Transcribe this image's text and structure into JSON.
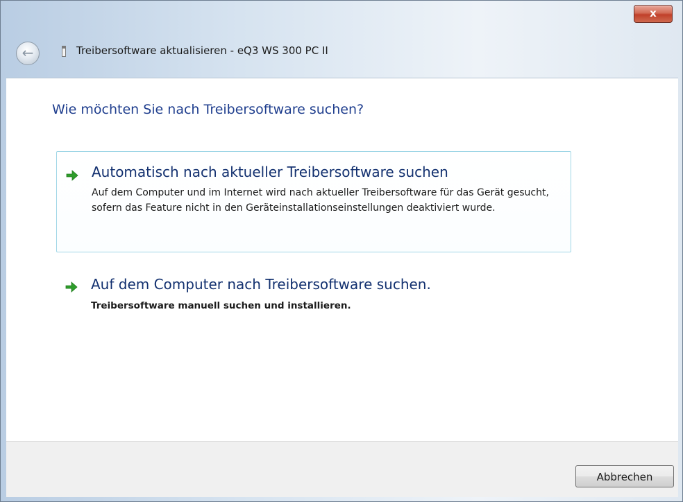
{
  "window": {
    "title": "Treibersoftware aktualisieren - eQ3 WS 300 PC II",
    "close_label": "x"
  },
  "main": {
    "heading": "Wie möchten Sie nach Treibersoftware suchen?",
    "options": [
      {
        "title": "Automatisch nach aktueller Treibersoftware suchen",
        "description": "Auf dem Computer und im Internet wird nach aktueller Treibersoftware für das Gerät gesucht, sofern das Feature nicht in den Geräteinstallationseinstellungen deaktiviert wurde."
      },
      {
        "title": "Auf dem Computer nach Treibersoftware suchen.",
        "description": "Treibersoftware manuell suchen und installieren."
      }
    ]
  },
  "footer": {
    "cancel_label": "Abbrechen"
  },
  "colors": {
    "heading": "#1f3e8e",
    "arrow": "#2e9d2b",
    "option_border": "#9fd6e6"
  },
  "icons": [
    "back-arrow-icon",
    "device-icon",
    "green-arrow-icon",
    "close-icon"
  ]
}
